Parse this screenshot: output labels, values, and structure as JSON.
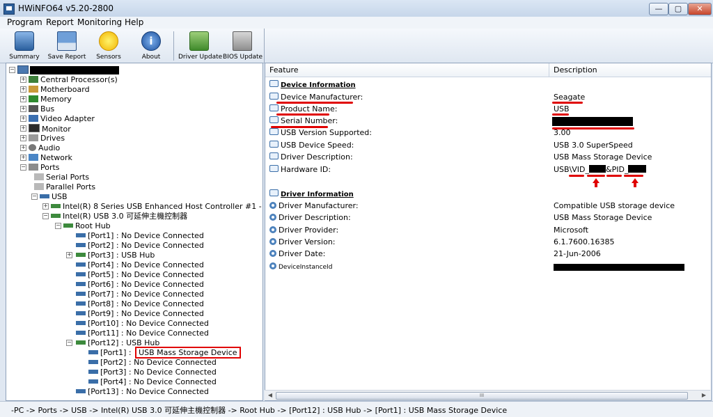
{
  "window": {
    "title": "HWiNFO64 v5.20-2800",
    "minimize": "—",
    "maximize": "▢",
    "close": "✕"
  },
  "menu": [
    "Program",
    "Report",
    "Monitoring",
    "Help"
  ],
  "toolbar": {
    "summary": "Summary",
    "save_report": "Save Report",
    "sensors": "Sensors",
    "about": "About",
    "driver_update": "Driver Update",
    "bios_update": "BIOS Update"
  },
  "tree": {
    "central_processor": "Central Processor(s)",
    "motherboard": "Motherboard",
    "memory": "Memory",
    "bus": "Bus",
    "video_adapter": "Video Adapter",
    "monitor": "Monitor",
    "drives": "Drives",
    "audio": "Audio",
    "network": "Network",
    "ports": "Ports",
    "serial_ports": "Serial Ports",
    "parallel_ports": "Parallel Ports",
    "usb": "USB",
    "controller_1": "Intel(R) 8 Series USB Enhanced Host Controller #1 -",
    "controller_2": "Intel(R) USB 3.0 可延伸主機控制器",
    "root_hub": "Root Hub",
    "port1": "[Port1] : No Device Connected",
    "port2": "[Port2] : No Device Connected",
    "port3": "[Port3] : USB Hub",
    "port4": "[Port4] : No Device Connected",
    "port5": "[Port5] : No Device Connected",
    "port6": "[Port6] : No Device Connected",
    "port7": "[Port7] : No Device Connected",
    "port8": "[Port8] : No Device Connected",
    "port9": "[Port9] : No Device Connected",
    "port10": "[Port10] : No Device Connected",
    "port11": "[Port11] : No Device Connected",
    "port12": "[Port12] : USB Hub",
    "sub_port1_prefix": "[Port1] : ",
    "sub_port1_device": "USB Mass Storage Device",
    "sub_port2": "[Port2] : No Device Connected",
    "sub_port3": "[Port3] : No Device Connected",
    "sub_port4": "[Port4] : No Device Connected",
    "port13": "[Port13] : No Device Connected"
  },
  "details": {
    "col_feature": "Feature",
    "col_description": "Description",
    "device_info_header": "Device Information",
    "device_rows": [
      {
        "feature": "Device Manufacturer:",
        "value": "Seagate"
      },
      {
        "feature": "Product Name:",
        "value": "USB"
      },
      {
        "feature": "Serial Number:",
        "value": ""
      },
      {
        "feature": "USB Version Supported:",
        "value": "3.00"
      },
      {
        "feature": "USB Device Speed:",
        "value": "USB 3.0 SuperSpeed"
      },
      {
        "feature": "Driver Description:",
        "value": "USB Mass Storage Device"
      },
      {
        "feature": "Hardware ID:",
        "value": "USB\\VID_"
      }
    ],
    "hardware_id_pid": "&PID_",
    "driver_info_header": "Driver Information",
    "driver_rows": [
      {
        "feature": "Driver Manufacturer:",
        "value": "Compatible USB storage device"
      },
      {
        "feature": "Driver Description:",
        "value": "USB Mass Storage Device"
      },
      {
        "feature": "Driver Provider:",
        "value": "Microsoft"
      },
      {
        "feature": "Driver Version:",
        "value": "6.1.7600.16385"
      },
      {
        "feature": "Driver Date:",
        "value": "21-Jun-2006"
      },
      {
        "feature": "DeviceInstanceId",
        "value": ""
      }
    ]
  },
  "scrollbar": {
    "left": "◀",
    "right": "▶",
    "thumb": "III"
  },
  "status": "-PC -> Ports -> USB -> Intel(R) USB 3.0 可延伸主機控制器 -> Root Hub -> [Port12] : USB Hub -> [Port1] : USB Mass Storage Device",
  "colors": {
    "highlight": "#e00000",
    "title_bg": "#c6d6ea",
    "panel_border": "#8ea1bb"
  },
  "icons": {
    "summary": "summary-icon",
    "save_report": "floppy-icon",
    "sensors": "lightning-icon",
    "about": "info-icon",
    "driver_update": "driver-icon",
    "bios_update": "chip-icon"
  }
}
